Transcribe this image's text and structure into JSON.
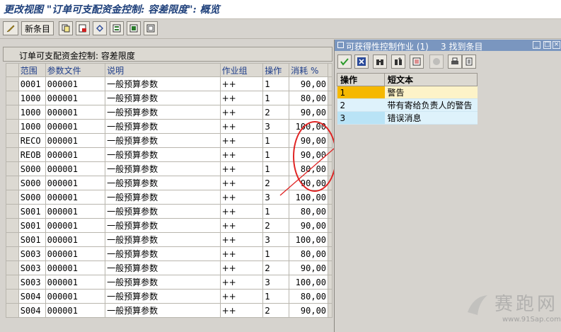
{
  "window": {
    "title": "更改视图 \"订单可支配资金控制: 容差限度\": 概览"
  },
  "toolbar": {
    "new_entries_label": "新条目"
  },
  "main": {
    "caption": "订单可支配资金控制: 容差限度",
    "columns": [
      "范围",
      "参数文件",
      "说明",
      "作业组",
      "操作",
      "消耗 %"
    ],
    "rows": [
      {
        "area": "0001",
        "profile": "000001",
        "desc": "一般预算参数",
        "group": "++",
        "op": "1",
        "pct": "90,00"
      },
      {
        "area": "1000",
        "profile": "000001",
        "desc": "一般预算参数",
        "group": "++",
        "op": "1",
        "pct": "80,00"
      },
      {
        "area": "1000",
        "profile": "000001",
        "desc": "一般预算参数",
        "group": "++",
        "op": "2",
        "pct": "90,00"
      },
      {
        "area": "1000",
        "profile": "000001",
        "desc": "一般预算参数",
        "group": "++",
        "op": "3",
        "pct": "100,00"
      },
      {
        "area": "RECO",
        "profile": "000001",
        "desc": "一般预算参数",
        "group": "++",
        "op": "1",
        "pct": "90,00"
      },
      {
        "area": "REOB",
        "profile": "000001",
        "desc": "一般预算参数",
        "group": "++",
        "op": "1",
        "pct": "90,00"
      },
      {
        "area": "S000",
        "profile": "000001",
        "desc": "一般预算参数",
        "group": "++",
        "op": "1",
        "pct": "80,00"
      },
      {
        "area": "S000",
        "profile": "000001",
        "desc": "一般预算参数",
        "group": "++",
        "op": "2",
        "pct": "90,00"
      },
      {
        "area": "S000",
        "profile": "000001",
        "desc": "一般预算参数",
        "group": "++",
        "op": "3",
        "pct": "100,00"
      },
      {
        "area": "S001",
        "profile": "000001",
        "desc": "一般预算参数",
        "group": "++",
        "op": "1",
        "pct": "80,00"
      },
      {
        "area": "S001",
        "profile": "000001",
        "desc": "一般预算参数",
        "group": "++",
        "op": "2",
        "pct": "90,00"
      },
      {
        "area": "S001",
        "profile": "000001",
        "desc": "一般预算参数",
        "group": "++",
        "op": "3",
        "pct": "100,00"
      },
      {
        "area": "S003",
        "profile": "000001",
        "desc": "一般预算参数",
        "group": "++",
        "op": "1",
        "pct": "80,00"
      },
      {
        "area": "S003",
        "profile": "000001",
        "desc": "一般预算参数",
        "group": "++",
        "op": "2",
        "pct": "90,00"
      },
      {
        "area": "S003",
        "profile": "000001",
        "desc": "一般预算参数",
        "group": "++",
        "op": "3",
        "pct": "100,00"
      },
      {
        "area": "S004",
        "profile": "000001",
        "desc": "一般预算参数",
        "group": "++",
        "op": "1",
        "pct": "80,00"
      },
      {
        "area": "S004",
        "profile": "000001",
        "desc": "一般预算参数",
        "group": "++",
        "op": "2",
        "pct": "90,00"
      }
    ]
  },
  "popup": {
    "title": "可获得性控制作业 (1)",
    "count": "3 找到条目",
    "columns": [
      "操作",
      "短文本"
    ],
    "rows": [
      {
        "op": "1",
        "text": "警告"
      },
      {
        "op": "2",
        "text": "带有寄给负责人的警告"
      },
      {
        "op": "3",
        "text": "错误消息"
      }
    ]
  },
  "watermark": {
    "brand": "赛跑网",
    "url": "www.91Sap.com"
  },
  "colors": {
    "annotation": "#e02424",
    "popup_title_bg": "#7a96bf",
    "title_text": "#1d3f7a"
  }
}
